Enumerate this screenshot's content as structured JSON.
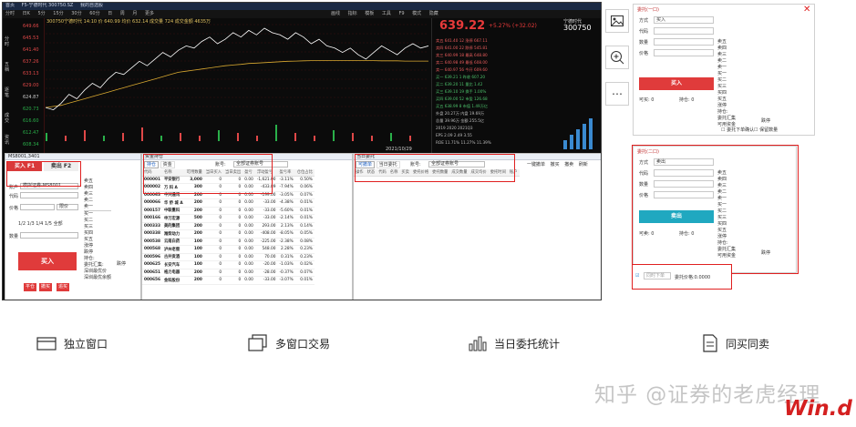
{
  "titlebar": {
    "app": "首页",
    "tab": "F5-宁德时代 300750.SZ",
    "tab2": "我的自选股"
  },
  "menubar": {
    "items": [
      "分时",
      "日K",
      "5分",
      "15分",
      "30分",
      "60分",
      "日",
      "周",
      "月",
      "更多"
    ],
    "right_items": [
      "画线",
      "指标",
      "模板",
      "工具",
      "F9",
      "模式",
      "隐藏"
    ]
  },
  "chart_info": "300750宁德时代 14:10  价 640.99  均价 632.14  成交量 724  成交金额 4635万",
  "chart_date": "2021/10/29",
  "axis_labels": [
    "649.66",
    "645.53",
    "641.40",
    "637.26",
    "633.13",
    "629.00",
    "624.87",
    "620.73",
    "616.60",
    "612.47",
    "608.34"
  ],
  "side_tabs": [
    "分时",
    "五档",
    "逐笔",
    "成交",
    "资讯"
  ],
  "chart_data": {
    "type": "line",
    "series": [
      {
        "values": [
          612,
          611,
          614,
          618,
          616,
          620,
          623,
          621,
          625,
          628,
          627,
          630,
          633,
          631,
          634,
          637,
          635,
          638,
          640,
          639,
          642,
          644,
          641,
          643,
          646,
          644,
          647,
          645,
          648,
          646,
          645,
          643,
          646,
          644,
          641,
          643,
          640,
          639,
          637,
          639,
          636,
          634,
          637,
          640,
          638,
          636,
          639,
          641,
          639,
          640
        ]
      },
      {
        "values": [
          612,
          612.5,
          613,
          614,
          615,
          616,
          617,
          618,
          619,
          620,
          621,
          622,
          623,
          624,
          625,
          626,
          627,
          628,
          628.5,
          629,
          629.5,
          630,
          630.5,
          631,
          631.3,
          631.6,
          632,
          632.2,
          632.4,
          632.6,
          632.8,
          633,
          633.1,
          633.2,
          633.3,
          633.3,
          633.4,
          633.4,
          633.4,
          633.4,
          633.3,
          633.3,
          633.3,
          633.2,
          633.2,
          633.2,
          633.1,
          633.1,
          633.1,
          633.1
        ]
      }
    ],
    "volume": [
      3,
      2,
      4,
      2,
      3,
      5,
      2,
      3,
      2,
      4,
      3,
      2,
      6,
      3,
      2,
      4,
      3,
      2,
      3,
      2
    ]
  },
  "quote": {
    "price": "639.22",
    "change": "+5.27% (+32.02)",
    "name": "宁德时代",
    "code": "300750",
    "rows": [
      "卖五  641.40    12      涨停  667.11",
      "卖四  641.00    22      跌停  545.81",
      "卖三  640.99    18      最高  648.80",
      "卖二  640.98    49      最低  608.00",
      "卖一  640.97    56      今开  609.60",
      "买一  639.21     1      昨收  607.20",
      "买二  639.20    11      量比  1.42",
      "买三  639.10    19      换手  1.00%",
      "买四  639.00    52      市盈  126.68",
      "买五  638.99     8      市值  1.49万亿",
      "外盘  20.27万   内盘  19.69万",
      "总量  39.96万   金额  255.5亿",
      "          2019     2020     2021Q3",
      "EPS     2.09     2.49     3.55",
      "ROE   11.71%   11.27%   11.39%"
    ]
  },
  "buy_panel": {
    "title": "MS8001,3401",
    "tab_buy": "买入 F1",
    "tab_sell": "卖出 F2",
    "account_label": "账户",
    "account_value": "模拟证券-MS8001...",
    "code_label": "代码",
    "price_label": "价格",
    "price_mode": "限价",
    "qty_label": "数量",
    "fractions": [
      "1/2",
      "1/3",
      "1/4",
      "1/5",
      "全部"
    ],
    "buy_button": "买入",
    "bottom_buttons": [
      "平仓",
      "撤买",
      "追买"
    ],
    "side_list": [
      "卖五",
      "卖四",
      "卖三",
      "卖二",
      "卖一",
      "买一",
      "买二",
      "买三",
      "买四",
      "买五",
      "涨停",
      "跌停",
      "持仓:",
      "委托汇集:",
      "深圳最优价",
      "深圳最优余额"
    ],
    "side_right": "跌停"
  },
  "holdings_panel": {
    "title": "资金持仓",
    "tabs": [
      "持仓",
      "资金"
    ],
    "filter_label": "账号:",
    "filter_value": "全部证券账号",
    "headers": [
      "代码",
      "名称",
      "可用数量",
      "当日买入",
      "当日卖出",
      "盈亏",
      "浮动盈亏",
      "盈亏率",
      "仓位占比"
    ],
    "rows": [
      [
        "000001",
        "平安银行",
        "3,000",
        "0",
        "0",
        "0.00",
        "-1,621.00",
        "-3.11%",
        "0.50%"
      ],
      [
        "000002",
        "万 科 A",
        "300",
        "0",
        "0",
        "0.00",
        "-433.89",
        "-7.94%",
        "0.06%"
      ],
      [
        "000063",
        "中兴通讯",
        "200",
        "0",
        "0",
        "0.00",
        "-199.00",
        "-3.05%",
        "0.07%"
      ],
      [
        "000066",
        "华 侨 城 A",
        "200",
        "0",
        "0",
        "0.00",
        "-33.00",
        "-4.38%",
        "0.01%"
      ],
      [
        "000157",
        "中联重科",
        "200",
        "0",
        "0",
        "0.00",
        "-33.00",
        "-5.60%",
        "0.01%"
      ],
      [
        "000166",
        "申万宏源",
        "500",
        "0",
        "0",
        "0.00",
        "-33.00",
        "-2.14%",
        "0.01%"
      ],
      [
        "000333",
        "美的集团",
        "200",
        "0",
        "0",
        "0.00",
        "293.00",
        "2.13%",
        "0.14%"
      ],
      [
        "000338",
        "潍柴动力",
        "200",
        "0",
        "0",
        "0.00",
        "-408.00",
        "-8.05%",
        "0.05%"
      ],
      [
        "000538",
        "云南白药",
        "100",
        "0",
        "0",
        "0.00",
        "-225.00",
        "-2.38%",
        "0.08%"
      ],
      [
        "000568",
        "泸州老窖",
        "100",
        "0",
        "0",
        "0.00",
        "548.00",
        "2.28%",
        "0.23%"
      ],
      [
        "000596",
        "古井贡酒",
        "100",
        "0",
        "0",
        "0.00",
        "70.00",
        "0.31%",
        "0.23%"
      ],
      [
        "000625",
        "长安汽车",
        "100",
        "0",
        "0",
        "0.00",
        "-20.00",
        "-1.03%",
        "0.02%"
      ],
      [
        "000651",
        "格力电器",
        "200",
        "0",
        "0",
        "0.00",
        "-28.00",
        "-0.37%",
        "0.07%"
      ],
      [
        "000656",
        "金科股份",
        "200",
        "0",
        "0",
        "0.00",
        "-33.00",
        "-3.07%",
        "0.01%"
      ]
    ]
  },
  "orders_panel": {
    "title": "当日委托",
    "tabs": [
      "可撤单",
      "当日委托"
    ],
    "filter_label": "账号:",
    "filter_value": "全部证券账号",
    "top_buttons": [
      "一键撤单",
      "撤买",
      "撤卖",
      "刷新"
    ],
    "headers": [
      "操作",
      "状态",
      "代码",
      "名称",
      "买卖",
      "委托价格",
      "委托数量",
      "成交数量",
      "成交均价",
      "委托时间",
      "账户"
    ]
  },
  "features": [
    {
      "icon": "window-icon",
      "label": "独立窗口"
    },
    {
      "icon": "multi-window-icon",
      "label": "多窗口交易"
    },
    {
      "icon": "bar-chart-icon",
      "label": "当日委托统计"
    },
    {
      "icon": "document-icon",
      "label": "同买同卖"
    }
  ],
  "buy_mini": {
    "title": "委托(一口)",
    "fields": [
      [
        "方式",
        "买入"
      ],
      [
        "代码",
        ""
      ],
      [
        "数量",
        ""
      ],
      [
        "价格",
        ""
      ]
    ],
    "list": [
      "卖五",
      "卖四",
      "卖三",
      "卖二",
      "卖一",
      "买一",
      "买二",
      "买三",
      "买四",
      "买五",
      "涨停",
      "持仓:",
      "委托汇集",
      "可用资金"
    ],
    "list_right": "跌停",
    "button": "买入",
    "avail": "可买: 0",
    "hold": "持仓: 0",
    "checks": [
      "委托下单确认",
      "保留数量"
    ]
  },
  "sell_mini": {
    "title": "委托(二口)",
    "fields": [
      [
        "方式",
        "卖出"
      ],
      [
        "代码",
        ""
      ],
      [
        "数量",
        ""
      ],
      [
        "价格",
        ""
      ]
    ],
    "list": [
      "卖五",
      "卖四",
      "卖三",
      "卖二",
      "卖一",
      "买一",
      "买二",
      "买三",
      "买四",
      "买五",
      "涨停",
      "持仓:",
      "委托汇集",
      "可用资金"
    ],
    "list_right": "跌停",
    "button": "卖出",
    "avail": "可卖: 0",
    "hold": "持仓: 0",
    "sync_label": "同时下单",
    "sync_value": "委托价格:0.0000"
  },
  "watermark": "知乎 @证券的老虎经理",
  "logo": "Win.d",
  "colors": {
    "red": "#e02020",
    "green": "#1a9a3a",
    "button_red": "#e03b3b",
    "button_teal": "#20a8c0"
  }
}
